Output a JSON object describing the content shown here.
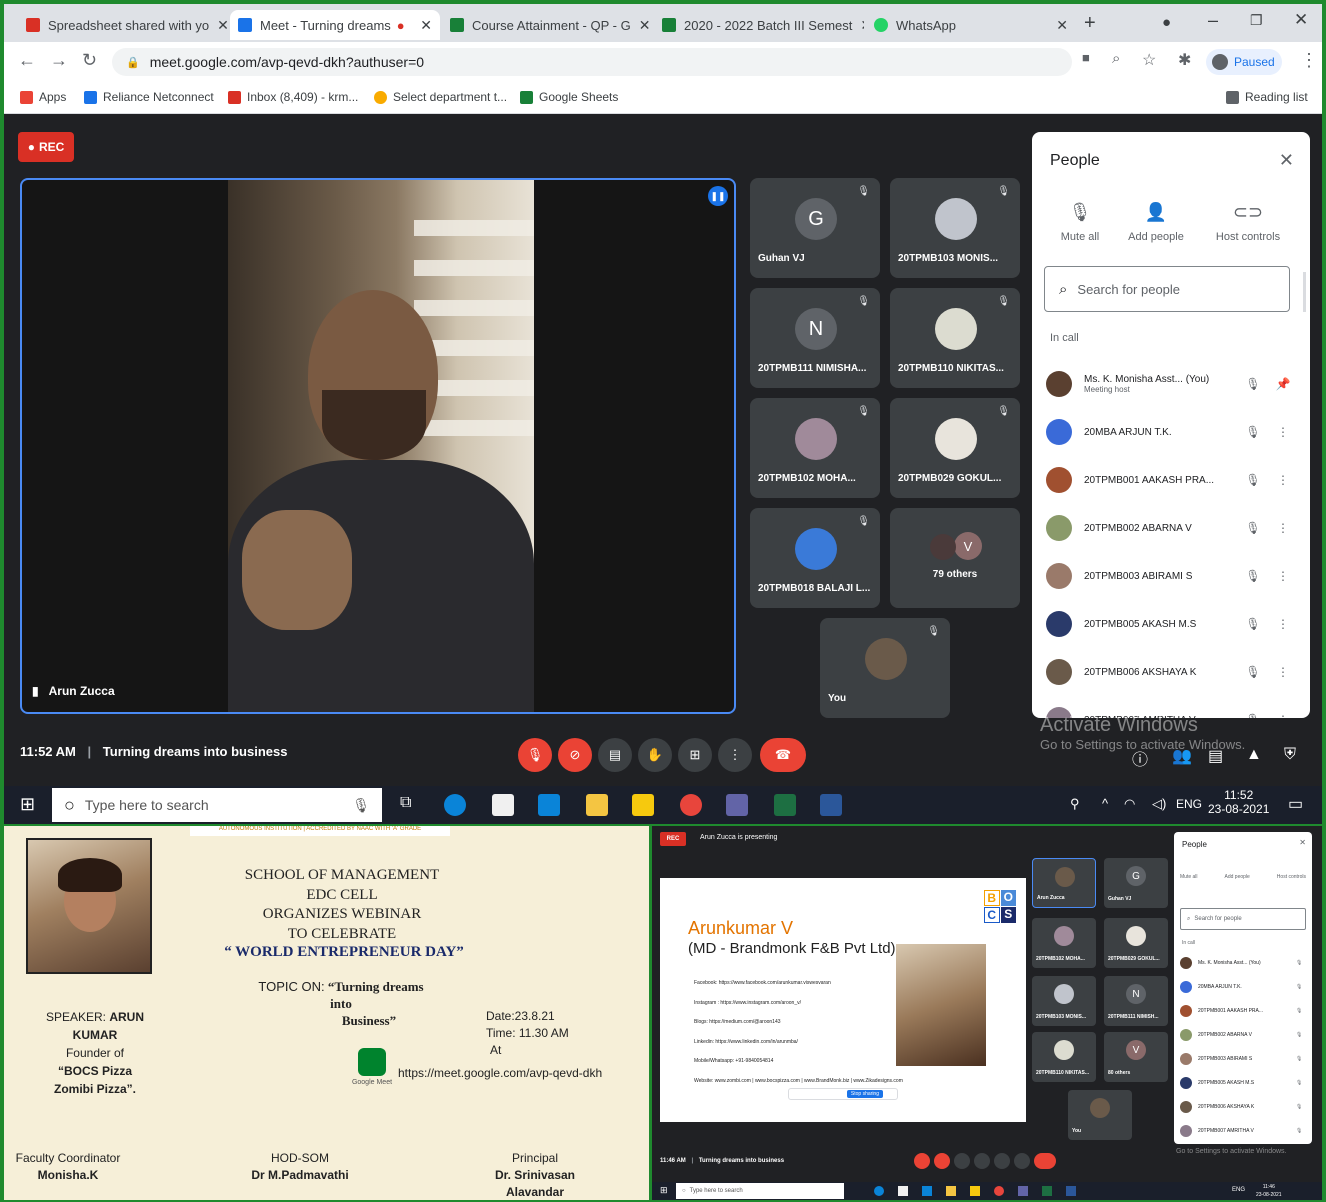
{
  "browser": {
    "tabs": [
      {
        "label": "Spreadsheet shared with yo",
        "icon": "gmail-icon",
        "color": "#d93025"
      },
      {
        "label": "Meet - Turning dreams",
        "icon": "meet-icon",
        "color": "#1a73e8"
      },
      {
        "label": "Course Attainment - QP - G",
        "icon": "sheets-icon",
        "color": "#188038"
      },
      {
        "label": "2020 - 2022 Batch III Semest",
        "icon": "sheets-icon",
        "color": "#188038"
      },
      {
        "label": "WhatsApp",
        "icon": "whatsapp-icon",
        "color": "#25d366"
      }
    ],
    "url": "meet.google.com/avp-qevd-dkh?authuser=0",
    "profile_label": "Paused",
    "bookmarks": [
      {
        "label": "Apps",
        "icon": "apps-icon"
      },
      {
        "label": "Reliance Netconnect",
        "icon": "reliance-icon"
      },
      {
        "label": "Inbox (8,409) - krm...",
        "icon": "gmail-icon"
      },
      {
        "label": "Select department t...",
        "icon": "department-icon"
      },
      {
        "label": "Google Sheets",
        "icon": "sheets-icon"
      }
    ],
    "reading_list": "Reading list"
  },
  "meet": {
    "rec_label": "REC",
    "speaker_name": "Arun Zucca",
    "time": "11:52 AM",
    "meeting_title": "Turning dreams into business",
    "tiles": [
      {
        "name": "Guhan VJ",
        "initial": "G",
        "color": "#5f6368"
      },
      {
        "name": "20TPMB103 MONIS...",
        "initial": "",
        "color": "#9aa0a6"
      },
      {
        "name": "20TPMB111 NIMISHA...",
        "initial": "N",
        "color": "#5f6368"
      },
      {
        "name": "20TPMB110 NIKITAS...",
        "initial": "",
        "color": "#9aa0a6"
      },
      {
        "name": "20TPMB102 MOHA...",
        "initial": "",
        "color": "#a08a9a"
      },
      {
        "name": "20TPMB029 GOKUL...",
        "initial": "",
        "color": "#6a6a6a"
      },
      {
        "name": "20TPMB018 BALAJI L...",
        "initial": "",
        "color": "#3a7ad8"
      },
      {
        "name": "79 others",
        "initial": "V",
        "color": "#8a6a6a"
      },
      {
        "name": "You",
        "initial": "",
        "color": "#6a5a4a"
      }
    ],
    "people_panel": {
      "title": "People",
      "actions": [
        "Mute all",
        "Add people",
        "Host controls"
      ],
      "search_placeholder": "Search for people",
      "section": "In call",
      "participants": [
        {
          "name": "Ms. K. Monisha Asst... (You)",
          "sub": "Meeting host",
          "color": "#5a4030"
        },
        {
          "name": "20MBA ARJUN T.K.",
          "sub": "",
          "color": "#3a6ad8"
        },
        {
          "name": "20TPMB001 AAKASH PRA...",
          "sub": "",
          "color": "#a05030"
        },
        {
          "name": "20TPMB002 ABARNA V",
          "sub": "",
          "color": "#8a9a6a"
        },
        {
          "name": "20TPMB003 ABIRAMI S",
          "sub": "",
          "color": "#9a7a6a"
        },
        {
          "name": "20TPMB005 AKASH M.S",
          "sub": "",
          "color": "#2a3a6a"
        },
        {
          "name": "20TPMB006 AKSHAYA K",
          "sub": "",
          "color": "#6a5a4a"
        },
        {
          "name": "20TPMB007 AMRITHA V",
          "sub": "",
          "color": "#8a7a8a"
        }
      ]
    },
    "watermark_1": "Activate Windows",
    "watermark_2": "Go to Settings to activate Windows."
  },
  "taskbar": {
    "search_placeholder": "Type here to search",
    "lang": "ENG",
    "clock_time": "11:52",
    "clock_date": "23-08-2021"
  },
  "poster": {
    "header_small": "AUTONOMOUS INSTITUTION | ACCREDITED BY NAAC WITH 'A' GRADE",
    "line1": "SCHOOL OF MANAGEMENT",
    "line2": "EDC CELL",
    "line3": "ORGANIZES WEBINAR",
    "line4": "TO CELEBRATE",
    "line5": "“ WORLD ENTREPRENEUR DAY”",
    "topic_label": "TOPIC ON:",
    "topic_a": "“Turning dreams into",
    "topic_b": "Business”",
    "speaker_label": "SPEAKER:",
    "speaker_name": "ARUN KUMAR",
    "founder_line": "Founder of",
    "company_a": "“BOCS Pizza",
    "company_b": "Zomibi Pizza”.",
    "date": "Date:23.8.21",
    "time": "Time: 11.30 AM",
    "at": "At",
    "link": "https://meet.google.com/avp-qevd-dkh",
    "meet_logo_label": "Google Meet",
    "coord_label": "Faculty Coordinator",
    "coord_name": "Monisha.K",
    "hod_label": "HOD-SOM",
    "hod_name": "Dr M.Padmavathi",
    "principal_label": "Principal",
    "principal_name_a": "Dr. Srinivasan",
    "principal_name_b": "Alavandar"
  },
  "mini": {
    "rec_label": "REC",
    "presenting": "Arun Zucca is presenting",
    "slide_name": "Arunkumar V",
    "slide_title": "(MD - Brandmonk F&B Pvt Ltd)",
    "slide_logo": [
      "B",
      "O",
      "C",
      "S"
    ],
    "slide_lines": [
      "Facebook: https://www.facebook.com/arunkumar.viswesvaran",
      "Instagram : https://www.instagram.com/aroon_v/",
      "Blogs: https://medium.com/@aroon143",
      "Linkedin: https://www.linkedin.com/in/arunmba/",
      "Mobile/Whatsapp: +91-9840054814",
      "Website: www.zombi.com | www.bocspizza.com | www.BrandMonk.biz | www.Zikadesigns.com"
    ],
    "share_bar_btn": "Stop sharing",
    "tiles": [
      {
        "name": "Arun Zucca",
        "initial": ""
      },
      {
        "name": "Guhan VJ",
        "initial": "G"
      },
      {
        "name": "20TPMB102 MOHA...",
        "initial": ""
      },
      {
        "name": "20TPMB029 GOKUL...",
        "initial": ""
      },
      {
        "name": "20TPMB103 MONIS...",
        "initial": ""
      },
      {
        "name": "20TPMB111 NIMISH...",
        "initial": "N"
      },
      {
        "name": "20TPMB110 NIKITAS...",
        "initial": ""
      },
      {
        "name": "80 others",
        "initial": "V"
      },
      {
        "name": "You",
        "initial": ""
      }
    ],
    "people_title": "People",
    "people_actions": [
      "Mute all",
      "Add people",
      "Host controls"
    ],
    "people_search": "Search for people",
    "people_section": "In call",
    "participants": [
      "Ms. K. Monisha Asst... (You)",
      "20MBA ARJUN T.K.",
      "20TPMB001 AAKASH PRA...",
      "20TPMB002 ABARNA V",
      "20TPMB003 ABIRAMI S",
      "20TPMB005 AKASH M.S",
      "20TPMB006 AKSHAYA K",
      "20TPMB007 AMRITHA V"
    ],
    "time": "11:46 AM",
    "meeting_title": "Turning dreams into business",
    "taskbar_search": "Type here to search",
    "lang": "ENG",
    "clock_time": "11:46",
    "clock_date": "23-08-2021",
    "watermark": "Go to Settings to activate Windows."
  }
}
